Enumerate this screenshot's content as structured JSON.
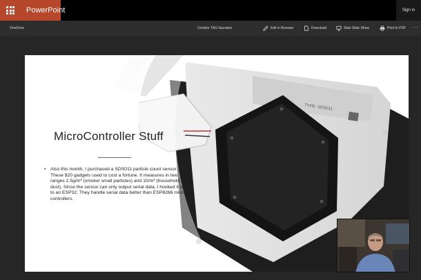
{
  "app": {
    "name": "PowerPoint",
    "sign_in": "Sign in"
  },
  "location": {
    "onedrive": "OneDrive"
  },
  "document": {
    "title": "October TAG Narrated"
  },
  "toolbar": {
    "edit_in_browser": "Edit in Browser",
    "download": "Download",
    "start_slide_show": "Start Slide Show",
    "print_to_pdf": "Print to PDF",
    "more": "···"
  },
  "slide": {
    "title": "MicroController Stuff",
    "bullet_marker": "•",
    "bullet": "Also this month, I purchased a SDS011 particle count sensor.  These $20 gadgets used to cost a fortune.  It measures in two ranges 2.5g/m³ (smoke/ small particles) and 10/m³ (household dust).  Since the sensor can only output serial data, I hooked it up to an ESP32.  They handle serial data better than ESP8266 micro controllers.",
    "sensor_label": "TYPE: SDS011"
  },
  "colors": {
    "brand": "#b7472a",
    "topbar": "#000000",
    "subbar": "#2d2d2d",
    "stage": "#262626"
  },
  "icons": [
    "waffle-icon",
    "pencil-icon",
    "download-icon",
    "slideshow-icon",
    "print-icon"
  ]
}
